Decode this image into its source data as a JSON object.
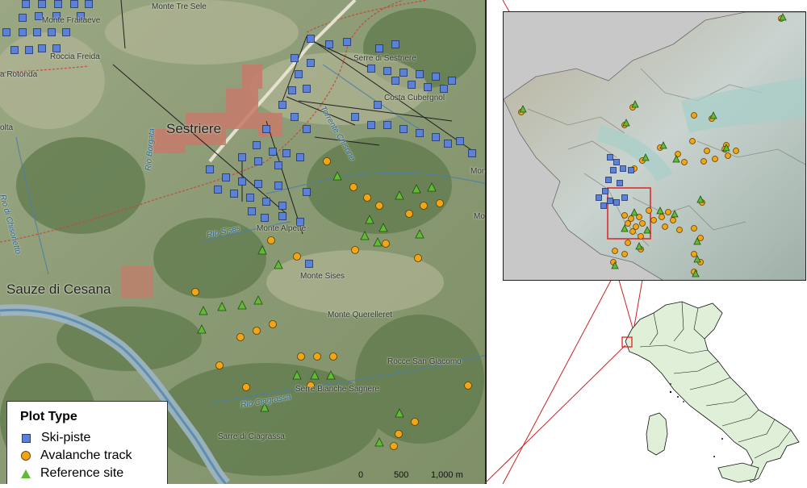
{
  "main_map": {
    "places": [
      {
        "id": "monte-tre-sele",
        "text": "Monte Tre Sele"
      },
      {
        "id": "monte-fraiteve",
        "text": "Monte Fraitaeve"
      },
      {
        "id": "roccia-freida",
        "text": "Roccia Freida"
      },
      {
        "id": "rotonda",
        "text": "a Rotonda"
      },
      {
        "id": "serre-sestriere",
        "text": "Serre di Sestriere"
      },
      {
        "id": "costa-cubergnol",
        "text": "Costa Cubergnol"
      },
      {
        "id": "colta",
        "text": "olta"
      },
      {
        "id": "sestriere",
        "text": "Sestriere"
      },
      {
        "id": "monte-alpette",
        "text": "Monte Alpette"
      },
      {
        "id": "monte-sises",
        "text": "Monte Sises"
      },
      {
        "id": "sauze-di-cesana",
        "text": "Sauze di Cesana"
      },
      {
        "id": "monte-querellet",
        "text": "Monte Querelleret"
      },
      {
        "id": "rocce-san-giacomo",
        "text": "Rocce San Giacomo"
      },
      {
        "id": "serre-bianche",
        "text": "Serre Bianche Sagnere"
      },
      {
        "id": "sarre-ciagrassa",
        "text": "Sarre di Ciagrassa"
      },
      {
        "id": "mont-right",
        "text": "Mont"
      },
      {
        "id": "mont-right2",
        "text": "Mo"
      }
    ],
    "rivers": [
      {
        "id": "rio-chisonetto",
        "text": "Rio di Chisonetto"
      },
      {
        "id": "rio-sises",
        "text": "Rio Sises"
      },
      {
        "id": "rio-ciagrassa",
        "text": "Rio Ciagrassa"
      },
      {
        "id": "torrente-chisone",
        "text": "Torrente Chisone"
      },
      {
        "id": "rio-borgata",
        "text": "Rio Borgata"
      }
    ],
    "colors": {
      "ski_piste": "#5b82d6",
      "avalanche_track": "#f2a516",
      "reference_site": "#62bb35"
    }
  },
  "legend": {
    "title": "Plot Type",
    "items": [
      {
        "label": "Ski-piste",
        "symbol": "square"
      },
      {
        "label": "Avalanche track",
        "symbol": "circle"
      },
      {
        "label": "Reference site",
        "symbol": "triangle"
      }
    ]
  },
  "scalebar": {
    "ticks": [
      "0",
      "500",
      "1,000 m"
    ]
  }
}
